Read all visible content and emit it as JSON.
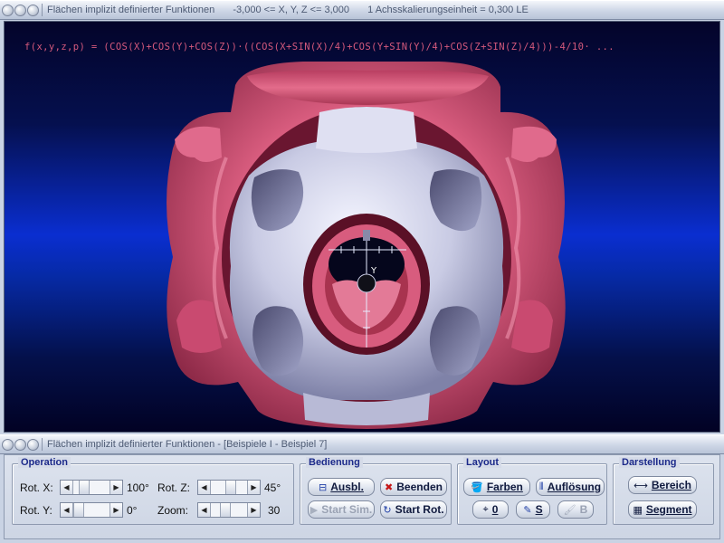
{
  "main_window": {
    "title": "Flächen implizit definierter Funktionen",
    "range": "-3,000 <= X, Y, Z <= 3,000",
    "scale": "1 Achsskalierungseinheit = 0,300 LE"
  },
  "plot": {
    "formula": "f(x,y,z,p) = (COS(X)+COS(Y)+COS(Z))·((COS(X+SIN(X)/4)+COS(Y+SIN(Y)/4)+COS(Z+SIN(Z)/4)))-4/10· ...",
    "axis_label_y": "Y",
    "colors": {
      "outer_surface": "#d85c7e",
      "inner_surface": "#c9cbe4",
      "background": "#0a2ed0"
    }
  },
  "control_window": {
    "title": "Flächen implizit definierter Funktionen - [Beispiele I - Beispiel 7]"
  },
  "operation": {
    "title": "Operation",
    "rot_x_label": "Rot. X:",
    "rot_x_value": "100°",
    "rot_y_label": "Rot. Y:",
    "rot_y_value": "0°",
    "rot_z_label": "Rot. Z:",
    "rot_z_value": "45°",
    "zoom_label": "Zoom:",
    "zoom_value": "30"
  },
  "bedienung": {
    "title": "Bedienung",
    "ausbl": "Ausbl.",
    "beenden": "Beenden",
    "start_sim": "Start Sim.",
    "start_rot": "Start Rot."
  },
  "layout": {
    "title": "Layout",
    "farben": "Farben",
    "aufloesung": "Auflösung",
    "o_label": "0",
    "s_label": "S",
    "b_label": "B"
  },
  "darstellung": {
    "title": "Darstellung",
    "bereich": "Bereich",
    "segment": "Segment"
  }
}
